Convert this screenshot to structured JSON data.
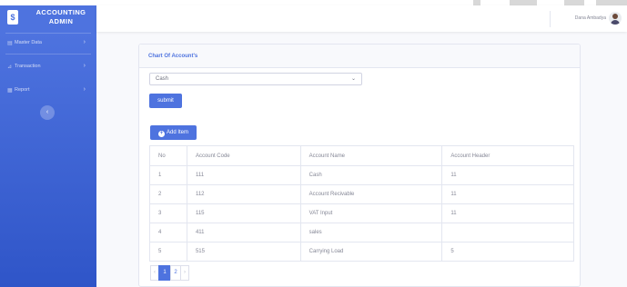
{
  "brand": {
    "icon": "receipt-icon",
    "line1": "ACCOUNTING",
    "line2": "ADMIN"
  },
  "sidebar": {
    "items": [
      {
        "label": "Master Data",
        "icon": "folder-icon"
      },
      {
        "label": "Transaction",
        "icon": "chart-icon"
      },
      {
        "label": "Report",
        "icon": "table-icon"
      }
    ],
    "toggle_icon": "chevron-left-icon"
  },
  "topbar": {
    "user_name": "Dana Ambadya"
  },
  "card": {
    "title": "Chart Of Account's",
    "select_value": "Cash",
    "submit_label": "submit",
    "add_label": "Add Item"
  },
  "table": {
    "headers": [
      "No",
      "Account Code",
      "Account Name",
      "Account Header"
    ],
    "rows": [
      [
        "1",
        "111",
        "Cash",
        "11"
      ],
      [
        "2",
        "112",
        "Account Recivable",
        "11"
      ],
      [
        "3",
        "115",
        "VAT Input",
        "11"
      ],
      [
        "4",
        "411",
        "sales",
        ""
      ],
      [
        "5",
        "515",
        "Carrying Load",
        "5"
      ]
    ]
  },
  "pagination": {
    "prev": "‹",
    "pages": [
      "1",
      "2"
    ],
    "next": "›",
    "active": "1"
  },
  "colors": {
    "primary": "#4e73df",
    "sidebar_bottom": "#2f55c8",
    "background": "#f8f9fc"
  }
}
